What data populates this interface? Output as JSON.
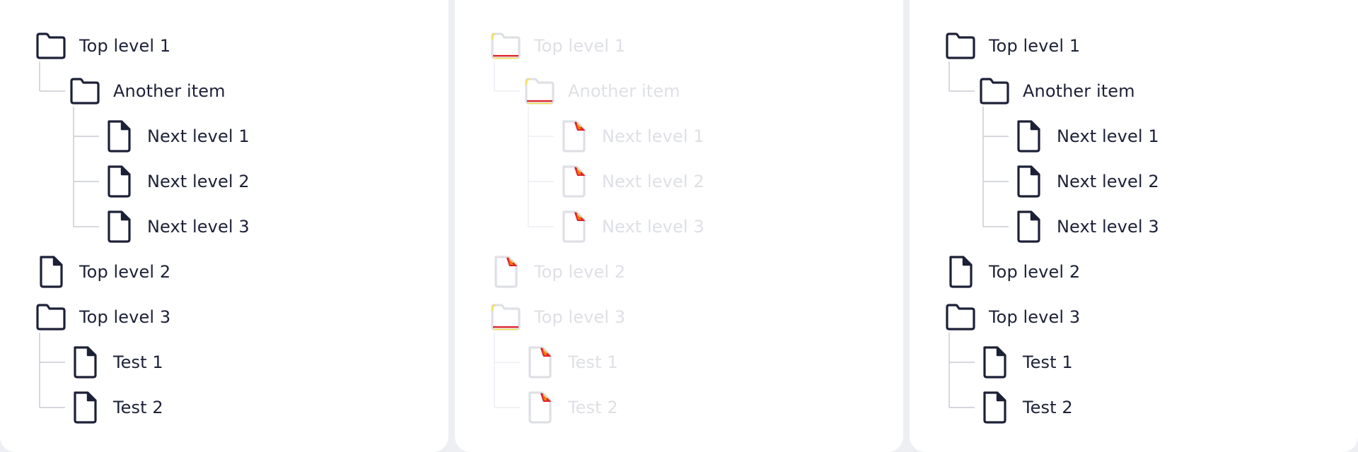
{
  "colors": {
    "text": "#1d2137",
    "icon_stroke": "#1d2137",
    "connector": "#c9ccd3",
    "disabled_text": "#dfe0e5",
    "disabled_icon": "#dfe0e5",
    "disabled_accent_yellow": "#f6e04c",
    "disabled_accent_red": "#e0202a",
    "disabled_accent_orange": "#ff7a00"
  },
  "panels": [
    {
      "state": "default",
      "nodes": [
        {
          "label": "Top level 1",
          "icon": "folder-icon",
          "depth": 0
        },
        {
          "label": "Another item",
          "icon": "folder-icon",
          "depth": 1
        },
        {
          "label": "Next level 1",
          "icon": "file-icon",
          "depth": 2
        },
        {
          "label": "Next level 2",
          "icon": "file-icon",
          "depth": 2
        },
        {
          "label": "Next level 3",
          "icon": "file-icon",
          "depth": 2
        },
        {
          "label": "Top level 2",
          "icon": "file-icon",
          "depth": 0
        },
        {
          "label": "Top level 3",
          "icon": "folder-icon",
          "depth": 0
        },
        {
          "label": "Test 1",
          "icon": "file-icon",
          "depth": 1
        },
        {
          "label": "Test 2",
          "icon": "file-icon",
          "depth": 1
        }
      ]
    },
    {
      "state": "disabled",
      "nodes": [
        {
          "label": "Top level 1",
          "icon": "folder-icon",
          "depth": 0
        },
        {
          "label": "Another item",
          "icon": "folder-icon",
          "depth": 1
        },
        {
          "label": "Next level 1",
          "icon": "file-icon",
          "depth": 2
        },
        {
          "label": "Next level 2",
          "icon": "file-icon",
          "depth": 2
        },
        {
          "label": "Next level 3",
          "icon": "file-icon",
          "depth": 2
        },
        {
          "label": "Top level 2",
          "icon": "file-icon",
          "depth": 0
        },
        {
          "label": "Top level 3",
          "icon": "folder-icon",
          "depth": 0
        },
        {
          "label": "Test 1",
          "icon": "file-icon",
          "depth": 1
        },
        {
          "label": "Test 2",
          "icon": "file-icon",
          "depth": 1
        }
      ]
    },
    {
      "state": "default",
      "nodes": [
        {
          "label": "Top level 1",
          "icon": "folder-icon",
          "depth": 0
        },
        {
          "label": "Another item",
          "icon": "folder-icon",
          "depth": 1
        },
        {
          "label": "Next level 1",
          "icon": "file-icon",
          "depth": 2
        },
        {
          "label": "Next level 2",
          "icon": "file-icon",
          "depth": 2
        },
        {
          "label": "Next level 3",
          "icon": "file-icon",
          "depth": 2
        },
        {
          "label": "Top level 2",
          "icon": "file-icon",
          "depth": 0
        },
        {
          "label": "Top level 3",
          "icon": "folder-icon",
          "depth": 0
        },
        {
          "label": "Test 1",
          "icon": "file-icon",
          "depth": 1
        },
        {
          "label": "Test 2",
          "icon": "file-icon",
          "depth": 1
        }
      ]
    }
  ]
}
